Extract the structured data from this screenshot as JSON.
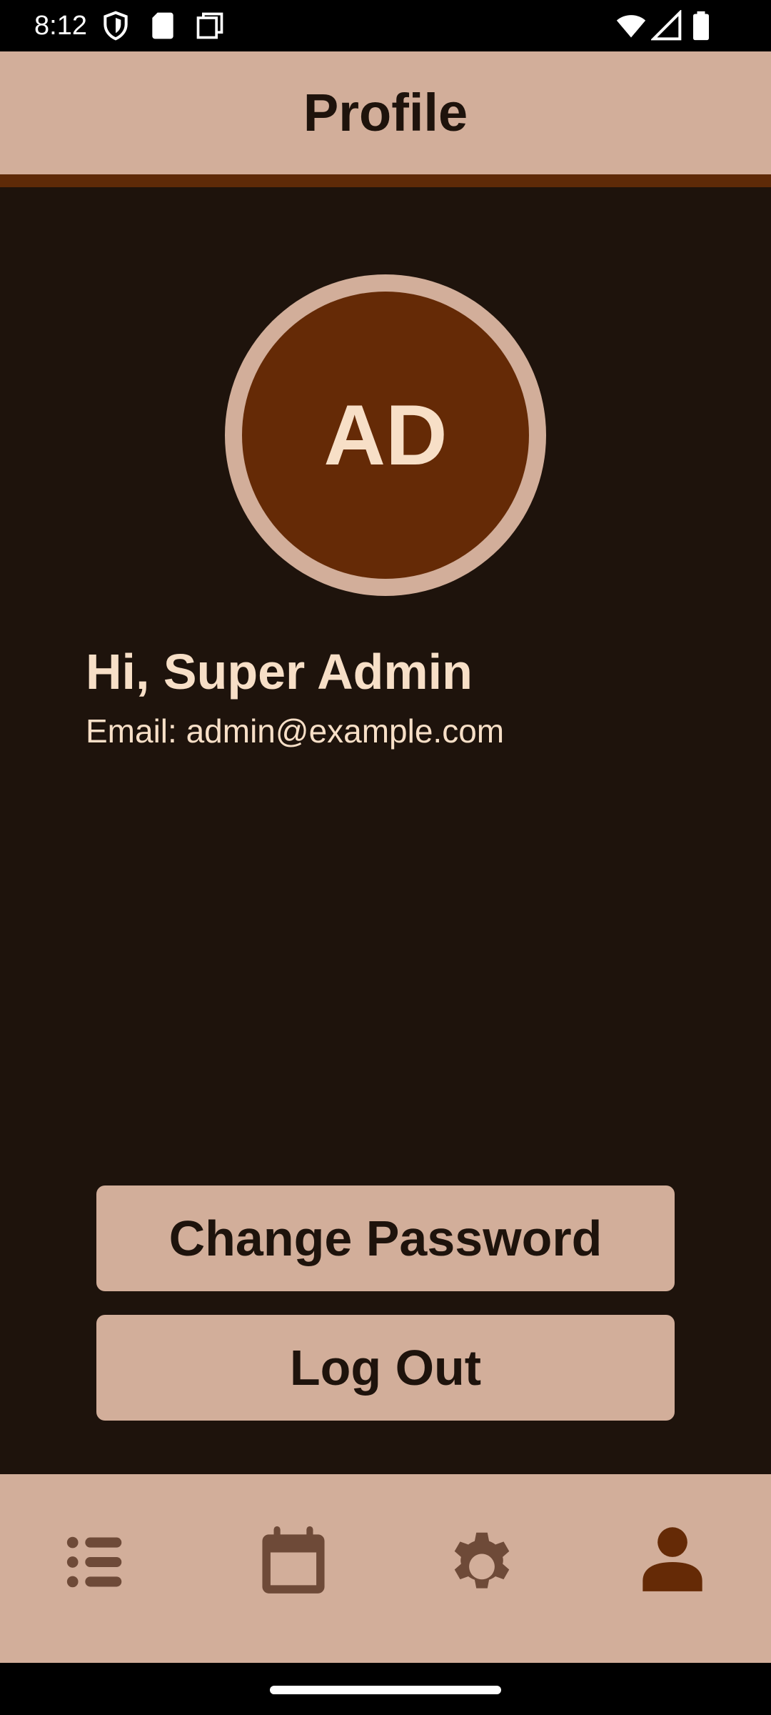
{
  "status_bar": {
    "time": "8:12"
  },
  "app_bar": {
    "title": "Profile"
  },
  "profile": {
    "initials": "AD",
    "greeting": "Hi, Super Admin",
    "email": "Email: admin@example.com"
  },
  "buttons": {
    "change_password": "Change Password",
    "log_out": "Log Out"
  },
  "bottom_nav": {
    "items": [
      {
        "icon": "list-icon",
        "selected": false
      },
      {
        "icon": "calendar-icon",
        "selected": false
      },
      {
        "icon": "gear-icon",
        "selected": false
      },
      {
        "icon": "person-icon",
        "selected": true
      }
    ]
  },
  "colors": {
    "background": "#1e130c",
    "surface": "#d2ae9a",
    "primary": "#652a06",
    "on_primary": "#f7dfc7",
    "nav_inactive": "#6e4a38",
    "nav_active": "#652a06"
  }
}
